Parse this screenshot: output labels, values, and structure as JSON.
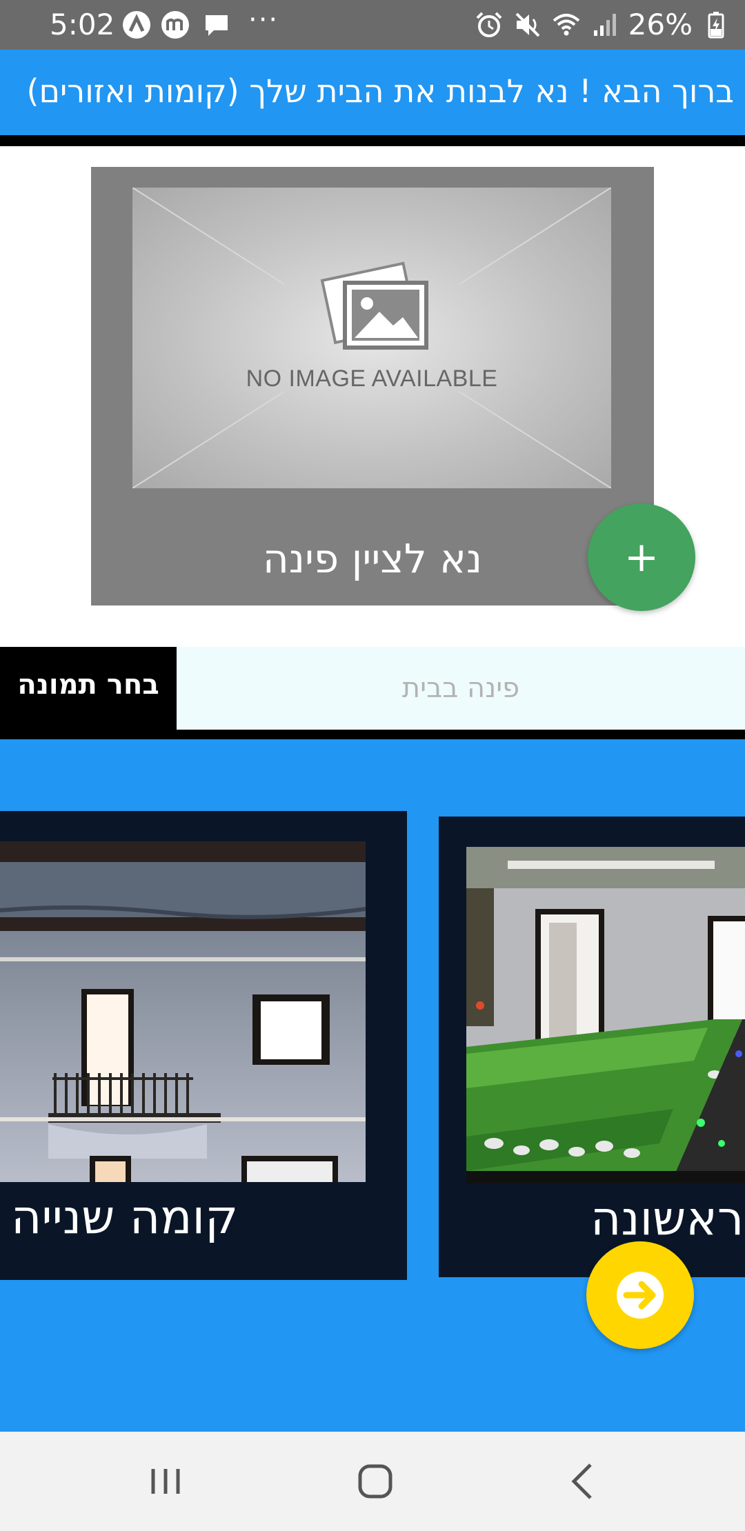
{
  "status_bar": {
    "time": "5:02",
    "overflow_dots": "···",
    "battery_percent": "26%",
    "left_icons": [
      "a-circle-icon",
      "m-circle-icon",
      "message-icon"
    ],
    "right_icons": [
      "alarm-icon",
      "mute-icon",
      "wifi-icon",
      "signal-icon",
      "battery-charging-icon"
    ]
  },
  "header": {
    "title": "ברוך הבא ! נא לבנות את הבית שלך (קומות ואזורים)",
    "background": "#2196f3"
  },
  "corner_card": {
    "placeholder_text": "NO IMAGE AVAILABLE",
    "caption": "נא לציין פינה",
    "add_button_glyph": "+",
    "add_button_color": "#43a35f"
  },
  "corner_form": {
    "choose_image_label": "בחר תמונה",
    "corner_input_placeholder": "פינה בבית",
    "corner_input_value": ""
  },
  "floors": {
    "items": [
      {
        "label": "קומה שנייה"
      },
      {
        "label": "ראשונה"
      }
    ],
    "next_button_color": "#ffd600"
  },
  "nav_bar": {
    "buttons": [
      "recent-apps-icon",
      "home-icon",
      "back-icon"
    ]
  }
}
